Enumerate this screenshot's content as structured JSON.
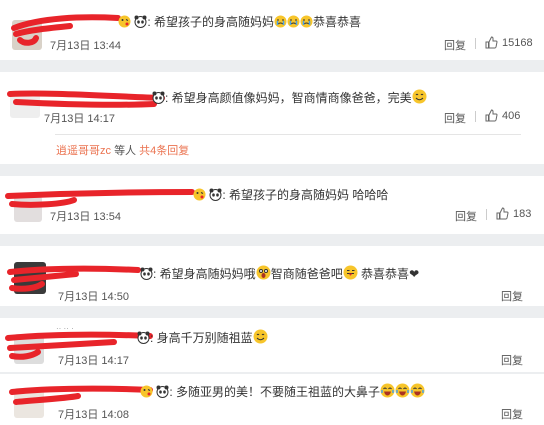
{
  "comments": [
    {
      "text_parts": [
        "希望孩子的身高随妈妈",
        "恭喜恭喜"
      ],
      "time": "7月13日 13:44",
      "reply": "回复",
      "likes": "15168"
    },
    {
      "text_parts": [
        "希望身高颜值像妈妈，智商情商像爸爸，完美"
      ],
      "time": "7月13日 14:17",
      "reply": "回复",
      "likes": "406",
      "sub": {
        "user": "逍遥哥哥zc",
        "text": "等人",
        "link": "共4条回复"
      }
    },
    {
      "text_parts": [
        "希望孩子的身高随妈妈 哈哈哈"
      ],
      "time": "7月13日 13:54",
      "reply": "回复",
      "likes": "183"
    },
    {
      "text_parts": [
        "希望身高随妈妈哦",
        "智商随爸爸吧",
        "恭喜恭喜"
      ],
      "time": "7月13日 14:50",
      "reply": "回复"
    },
    {
      "text_parts": [
        "身高千万别随祖蓝"
      ],
      "time": "7月13日 14:17",
      "reply": "回复"
    },
    {
      "text_parts": [
        "多随亚男的美！不要随王祖蓝的大鼻子"
      ],
      "time": "7月13日 14:08",
      "reply": "回复"
    }
  ],
  "icons": {
    "panda": "panda-icon",
    "kiss": "kiss-emoji-icon",
    "cry": "cry-emoji-icon",
    "smile": "smile-emoji-icon",
    "shock": "shocked-emoji-icon",
    "tongue": "tongue-emoji-icon",
    "heart": "heart-icon",
    "laugh": "laugh-cry-emoji-icon",
    "thumb": "thumbs-up-icon"
  },
  "colors": {
    "redaction": "#e8242a",
    "link": "#eb7350",
    "emoji": "#f7c52b"
  }
}
